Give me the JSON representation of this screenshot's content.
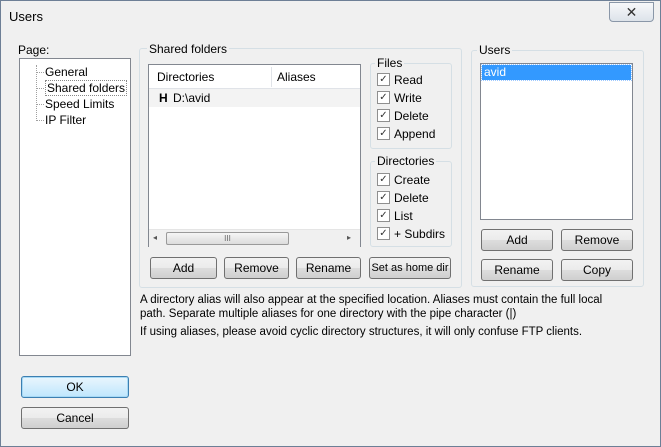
{
  "window": {
    "title": "Users",
    "close_glyph": "✕"
  },
  "page_panel": {
    "label": "Page:",
    "items": [
      {
        "label": "General",
        "selected": false
      },
      {
        "label": "Shared folders",
        "selected": true
      },
      {
        "label": "Speed Limits",
        "selected": false
      },
      {
        "label": "IP Filter",
        "selected": false
      }
    ]
  },
  "shared_folders": {
    "group_label": "Shared folders",
    "columns": [
      "Directories",
      "Aliases"
    ],
    "rows": [
      {
        "home_marker": "H",
        "directory": "D:\\avid",
        "alias": ""
      }
    ],
    "scroll_left": "◂",
    "scroll_right": "▸",
    "scroll_grip": "III",
    "buttons": {
      "add": "Add",
      "remove": "Remove",
      "rename": "Rename",
      "set_home": "Set as home dir"
    }
  },
  "files": {
    "group_label": "Files",
    "options": [
      {
        "label": "Read",
        "checked": true
      },
      {
        "label": "Write",
        "checked": true
      },
      {
        "label": "Delete",
        "checked": true
      },
      {
        "label": "Append",
        "checked": true
      }
    ]
  },
  "directories": {
    "group_label": "Directories",
    "options": [
      {
        "label": "Create",
        "checked": true
      },
      {
        "label": "Delete",
        "checked": true
      },
      {
        "label": "List",
        "checked": true
      },
      {
        "label": "+ Subdirs",
        "checked": true
      }
    ]
  },
  "users": {
    "group_label": "Users",
    "items": [
      {
        "label": "avid",
        "selected": true
      }
    ],
    "buttons": {
      "add": "Add",
      "remove": "Remove",
      "rename": "Rename",
      "copy": "Copy"
    }
  },
  "info": {
    "line1": "A directory alias will also appear at the specified location. Aliases must contain the full local",
    "line2": "path. Separate multiple aliases for one directory with the pipe character (|)",
    "line3": "If using aliases, please avoid cyclic directory structures, it will only confuse FTP clients."
  },
  "dialog_buttons": {
    "ok": "OK",
    "cancel": "Cancel"
  },
  "check_glyph": "✓",
  "colors": {
    "selection": "#3399ff",
    "accent_border": "#3c7fb1"
  }
}
